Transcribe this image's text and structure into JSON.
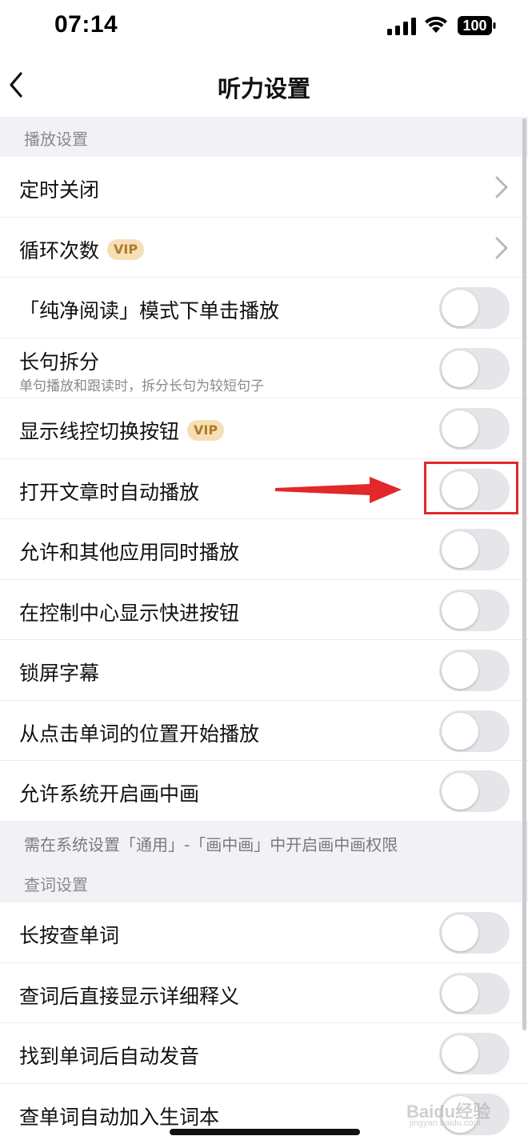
{
  "status_bar": {
    "time": "07:14",
    "battery": "100"
  },
  "nav": {
    "title": "听力设置",
    "back_icon": "chevron-left-icon"
  },
  "sections": {
    "playback": {
      "header": "播放设置",
      "rows": [
        {
          "label": "定时关闭",
          "control": "chevron"
        },
        {
          "label": "循环次数",
          "badge": "VIP",
          "control": "chevron"
        },
        {
          "label": "「纯净阅读」模式下单击播放",
          "control": "toggle",
          "on": false
        },
        {
          "label": "长句拆分",
          "sub": "单句播放和跟读时，拆分长句为较短句子",
          "control": "toggle",
          "on": false
        },
        {
          "label": "显示线控切换按钮",
          "badge": "VIP",
          "control": "toggle",
          "on": false
        },
        {
          "label": "打开文章时自动播放",
          "control": "toggle",
          "on": false,
          "highlighted": true
        },
        {
          "label": "允许和其他应用同时播放",
          "control": "toggle",
          "on": false
        },
        {
          "label": "在控制中心显示快进按钮",
          "control": "toggle",
          "on": false
        },
        {
          "label": "锁屏字幕",
          "control": "toggle",
          "on": false
        },
        {
          "label": "从点击单词的位置开始播放",
          "control": "toggle",
          "on": false
        },
        {
          "label": "允许系统开启画中画",
          "control": "toggle",
          "on": false
        }
      ],
      "note": "需在系统设置「通用」-「画中画」中开启画中画权限"
    },
    "lookup": {
      "header": "查词设置",
      "rows": [
        {
          "label": "长按查单词",
          "control": "toggle",
          "on": false
        },
        {
          "label": "查词后直接显示详细释义",
          "control": "toggle",
          "on": false
        },
        {
          "label": "找到单词后自动发音",
          "control": "toggle",
          "on": false
        },
        {
          "label": "查单词自动加入生词本",
          "control": "toggle",
          "on": false
        }
      ]
    }
  },
  "annotation": {
    "arrow_color": "#e2282a",
    "box_color": "#e2282a"
  },
  "watermark": {
    "main": "Baidu经验",
    "sub": "jingyan.baidu.com"
  },
  "colors": {
    "toggle_off": "#e5e5ea",
    "vip_bg": "#f6dfb4",
    "vip_text": "#b07a2c",
    "section_bg": "#f2f2f6"
  }
}
